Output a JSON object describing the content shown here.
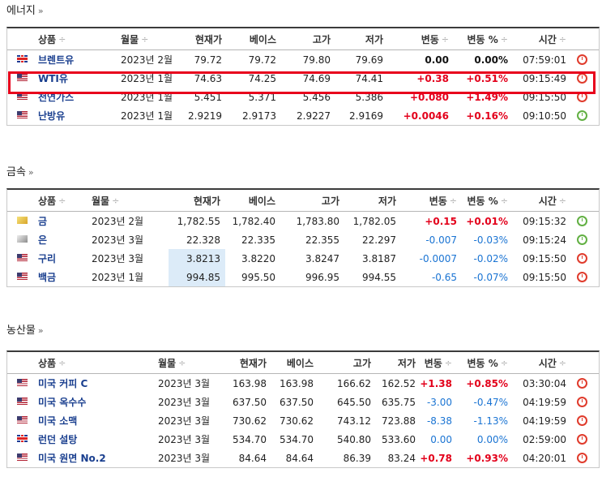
{
  "sections": [
    {
      "title": "에너지",
      "raquo": "»",
      "headers": {
        "product": "상품",
        "month": "월물",
        "current": "현재가",
        "base": "베이스",
        "high": "고가",
        "low": "저가",
        "change": "변동",
        "change_pct": "변동 %",
        "time": "시간",
        "sort": "÷"
      },
      "rows": [
        {
          "flag": "uk-flag-icon",
          "name": "브렌트유",
          "month": "2023년 2월",
          "current": "79.72",
          "base": "79.72",
          "high": "79.80",
          "low": "79.69",
          "change": "0.00",
          "change_pct": "0.00%",
          "time": "07:59:01",
          "clock": "red",
          "dir": "flat",
          "selected": false
        },
        {
          "flag": "us-flag-icon",
          "name": "WTI유",
          "month": "2023년 1월",
          "current": "74.63",
          "base": "74.25",
          "high": "74.69",
          "low": "74.41",
          "change": "+0.38",
          "change_pct": "+0.51%",
          "time": "09:15:49",
          "clock": "red",
          "dir": "pos",
          "selected": true
        },
        {
          "flag": "us-flag-icon",
          "name": "천연가스",
          "month": "2023년 1월",
          "current": "5.451",
          "base": "5.371",
          "high": "5.456",
          "low": "5.386",
          "change": "+0.080",
          "change_pct": "+1.49%",
          "time": "09:15:50",
          "clock": "red",
          "dir": "pos",
          "selected": false
        },
        {
          "flag": "us-flag-icon",
          "name": "난방유",
          "month": "2023년 1월",
          "current": "2.9219",
          "base": "2.9173",
          "high": "2.9227",
          "low": "2.9169",
          "change": "+0.0046",
          "change_pct": "+0.16%",
          "time": "09:10:50",
          "clock": "green",
          "dir": "pos",
          "selected": false
        }
      ]
    },
    {
      "title": "금속",
      "raquo": "»",
      "headers": {
        "product": "상품",
        "month": "월물",
        "current": "현재가",
        "base": "베이스",
        "high": "고가",
        "low": "저가",
        "change": "변동",
        "change_pct": "변동 %",
        "time": "시간",
        "sort": "÷"
      },
      "rows": [
        {
          "flag": "gold-icon",
          "name": "금",
          "month": "2023년 2월",
          "current": "1,782.55",
          "base": "1,782.40",
          "high": "1,783.80",
          "low": "1,782.05",
          "change": "+0.15",
          "change_pct": "+0.01%",
          "time": "09:15:32",
          "clock": "green",
          "dir": "pos"
        },
        {
          "flag": "silver-icon",
          "name": "은",
          "month": "2023년 3월",
          "current": "22.328",
          "base": "22.335",
          "high": "22.355",
          "low": "22.297",
          "change": "-0.007",
          "change_pct": "-0.03%",
          "time": "09:15:24",
          "clock": "green",
          "dir": "neg"
        },
        {
          "flag": "us-flag-icon",
          "name": "구리",
          "month": "2023년 3월",
          "current": "3.8213",
          "base": "3.8220",
          "high": "3.8247",
          "low": "3.8187",
          "change": "-0.0007",
          "change_pct": "-0.02%",
          "time": "09:15:50",
          "clock": "red",
          "dir": "neg",
          "highlight": true
        },
        {
          "flag": "us-flag-icon",
          "name": "백금",
          "month": "2023년 1월",
          "current": "994.85",
          "base": "995.50",
          "high": "996.95",
          "low": "994.55",
          "change": "-0.65",
          "change_pct": "-0.07%",
          "time": "09:15:50",
          "clock": "red",
          "dir": "neg",
          "highlight": true
        }
      ]
    },
    {
      "title": "농산물",
      "raquo": "»",
      "headers": {
        "product": "상품",
        "month": "월물",
        "current": "현재가",
        "base": "베이스",
        "high": "고가",
        "low": "저가",
        "change": "변동",
        "change_pct": "변동 %",
        "time": "시간",
        "sort": "÷"
      },
      "rows": [
        {
          "flag": "us-flag-icon",
          "name": "미국 커피 C",
          "month": "2023년 3월",
          "current": "163.98",
          "base": "163.98",
          "high": "166.62",
          "low": "162.52",
          "change": "+1.38",
          "change_pct": "+0.85%",
          "time": "03:30:04",
          "clock": "red",
          "dir": "pos"
        },
        {
          "flag": "us-flag-icon",
          "name": "미국 옥수수",
          "month": "2023년 3월",
          "current": "637.50",
          "base": "637.50",
          "high": "645.50",
          "low": "635.75",
          "change": "-3.00",
          "change_pct": "-0.47%",
          "time": "04:19:59",
          "clock": "red",
          "dir": "neg"
        },
        {
          "flag": "us-flag-icon",
          "name": "미국 소맥",
          "month": "2023년 3월",
          "current": "730.62",
          "base": "730.62",
          "high": "743.12",
          "low": "723.88",
          "change": "-8.38",
          "change_pct": "-1.13%",
          "time": "04:19:59",
          "clock": "red",
          "dir": "neg"
        },
        {
          "flag": "uk-flag-icon",
          "name": "런던 설탕",
          "month": "2023년 3월",
          "current": "534.70",
          "base": "534.70",
          "high": "540.80",
          "low": "533.60",
          "change": "0.00",
          "change_pct": "0.00%",
          "time": "02:59:00",
          "clock": "red",
          "dir": "zero"
        },
        {
          "flag": "us-flag-icon",
          "name": "미국 원면 No.2",
          "month": "2023년 3월",
          "current": "84.64",
          "base": "84.64",
          "high": "86.39",
          "low": "83.24",
          "change": "+0.78",
          "change_pct": "+0.93%",
          "time": "04:20:01",
          "clock": "red",
          "dir": "pos"
        }
      ]
    }
  ],
  "colors": {
    "up": "#e3001b",
    "down": "#1a74d3",
    "name": "#1a3f8f",
    "clock_red": "#e03b2c",
    "clock_green": "#62b043",
    "select_box": "#e8001c",
    "highlight": "#dcebf8"
  }
}
